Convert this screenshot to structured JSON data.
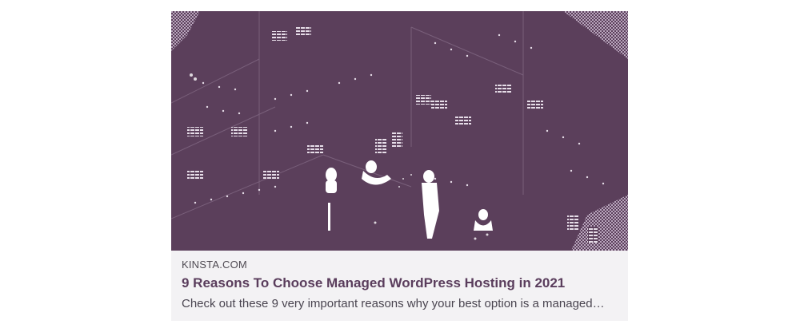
{
  "link_card": {
    "source": "KINSTA.COM",
    "title": "9 Reasons To Choose Managed WordPress Hosting in 2021",
    "description": "Check out these 9 very important reasons why your best option is a managed…",
    "image": {
      "subject": "illustration-people-in-isometric-office-building",
      "colors": {
        "background": "#5b3f5b",
        "wall": "#5b3f5b",
        "highlight": "#ffffff",
        "pattern": "#b9a6bd"
      }
    }
  },
  "colors": {
    "card_background": "#f3f2f4",
    "title": "#5a3d5c",
    "source": "#4f4a52",
    "description": "#4a4550"
  }
}
